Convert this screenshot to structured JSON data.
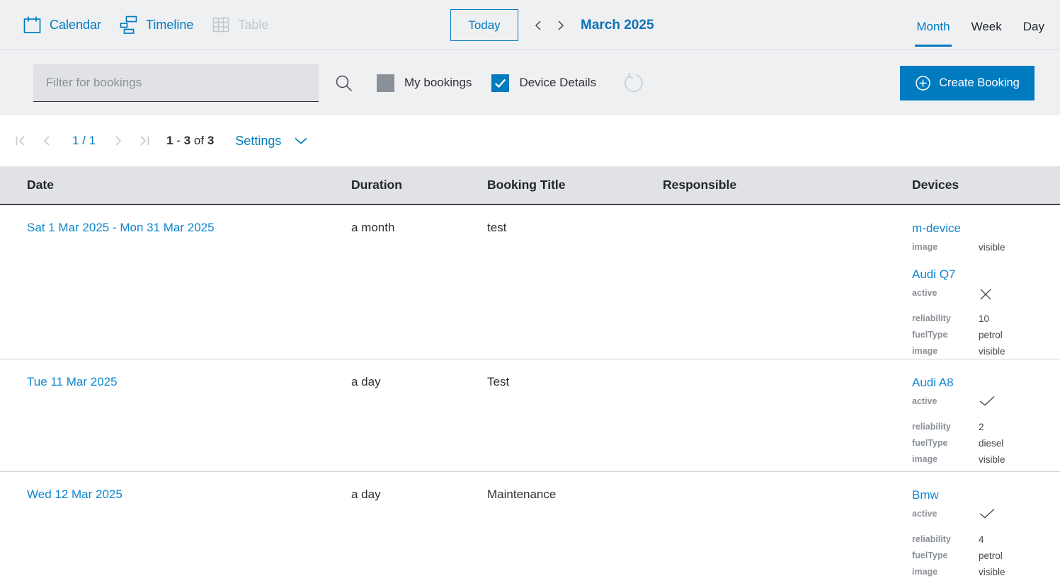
{
  "topbar": {
    "tabs": [
      {
        "label": "Calendar"
      },
      {
        "label": "Timeline"
      },
      {
        "label": "Table"
      }
    ],
    "today_button": "Today",
    "period_title": "March 2025",
    "views": [
      {
        "label": "Month"
      },
      {
        "label": "Week"
      },
      {
        "label": "Day"
      }
    ],
    "active_view": "Month"
  },
  "filter_bar": {
    "filter_placeholder": "Filter for bookings",
    "my_bookings_label": "My bookings",
    "my_bookings_checked": false,
    "device_details_label": "Device Details",
    "device_details_checked": true,
    "create_booking_label": "Create Booking"
  },
  "pagination": {
    "page_indicator": "1 / 1",
    "range_start": "1",
    "separator": "-",
    "range_end": "3",
    "of_label": "of",
    "total": "3",
    "settings_label": "Settings"
  },
  "colors": {
    "primary_blue": "#007bc0",
    "link_blue": "#0d87cf",
    "title_blue": "#0b72b5",
    "unchecked_gray": "#8a9097"
  },
  "table": {
    "headers": [
      "Date",
      "Duration",
      "Booking Title",
      "Responsible",
      "Devices"
    ],
    "rows": [
      {
        "date": "Sat 1 Mar 2025 - Mon 31 Mar 2025",
        "duration": "a month",
        "title": "test",
        "responsible": "",
        "devices": [
          {
            "name": "m-device",
            "attrs": [
              {
                "label": "image",
                "value": "visible"
              }
            ]
          },
          {
            "name": "Audi Q7",
            "attrs": [
              {
                "label": "active",
                "icon": "cross"
              },
              {
                "label": "reliability",
                "value": "10"
              },
              {
                "label": "fuelType",
                "value": "petrol"
              },
              {
                "label": "image",
                "value": "visible"
              }
            ]
          }
        ]
      },
      {
        "date": "Tue 11 Mar 2025",
        "duration": "a day",
        "title": "Test",
        "responsible": "",
        "devices": [
          {
            "name": "Audi A8",
            "attrs": [
              {
                "label": "active",
                "icon": "check"
              },
              {
                "label": "reliability",
                "value": "2"
              },
              {
                "label": "fuelType",
                "value": "diesel"
              },
              {
                "label": "image",
                "value": "visible"
              }
            ]
          }
        ]
      },
      {
        "date": "Wed 12 Mar 2025",
        "duration": "a day",
        "title": "Maintenance",
        "responsible": "",
        "devices": [
          {
            "name": "Bmw",
            "attrs": [
              {
                "label": "active",
                "icon": "check"
              },
              {
                "label": "reliability",
                "value": "4"
              },
              {
                "label": "fuelType",
                "value": "petrol"
              },
              {
                "label": "image",
                "value": "visible"
              }
            ]
          }
        ]
      }
    ]
  }
}
